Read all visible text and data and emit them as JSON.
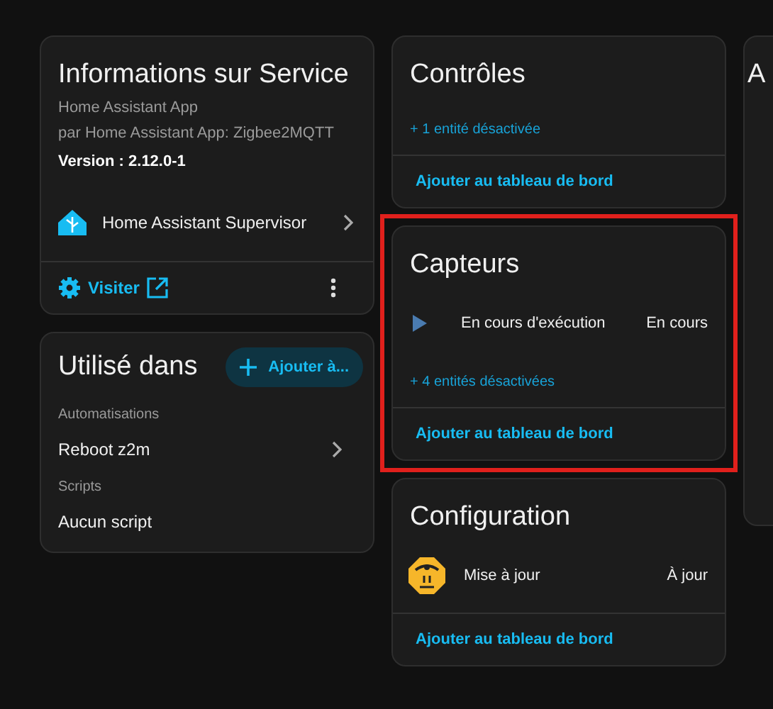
{
  "info_card": {
    "title": "Informations sur Service",
    "subtitle": "Home Assistant App",
    "by_line": "par Home Assistant App: Zigbee2MQTT",
    "version": "Version : 2.12.0-1",
    "link_item": "Home Assistant Supervisor",
    "visit_button": "Visiter"
  },
  "used_in_card": {
    "title": "Utilisé dans",
    "add_button": "Ajouter à...",
    "sections": [
      {
        "heading": "Automatisations",
        "item": "Reboot z2m",
        "link": true
      },
      {
        "heading": "Scripts",
        "item": "Aucun script",
        "link": false
      }
    ]
  },
  "entity_cards": [
    {
      "title": "Contrôles",
      "highlighted": false,
      "disabled_link": "+ 1 entité désactivée",
      "footer": "Ajouter au tableau de bord"
    },
    {
      "title": "Capteurs",
      "highlighted": true,
      "rows": [
        {
          "kind": "play",
          "name": "En cours d'exécution",
          "state": "En cours"
        }
      ],
      "disabled_link": "+ 4 entités désactivées",
      "footer": "Ajouter au tableau de bord"
    },
    {
      "title": "Configuration",
      "highlighted": false,
      "rows": [
        {
          "kind": "logo",
          "name": "Mise à jour",
          "state": "À jour"
        }
      ],
      "footer": "Ajouter au tableau de bord"
    }
  ],
  "side_card": {
    "title": "A"
  }
}
